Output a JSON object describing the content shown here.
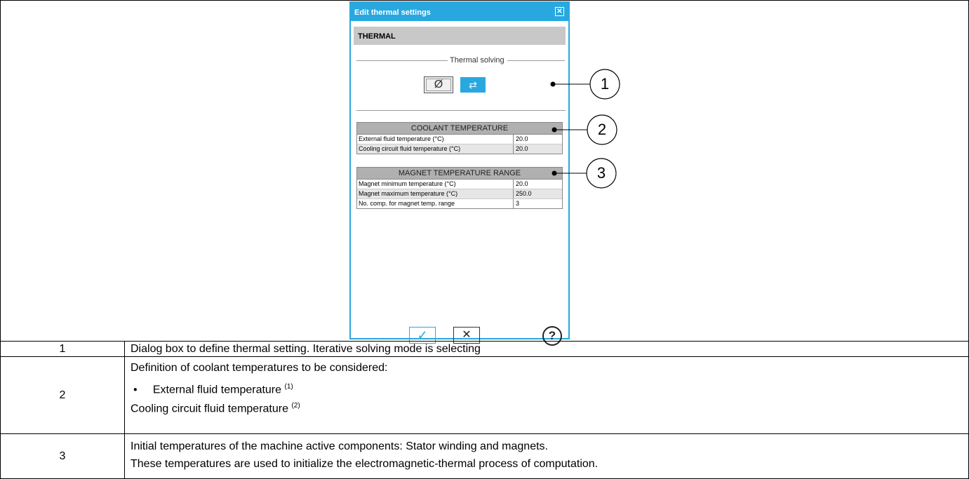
{
  "dialog": {
    "title": "Edit thermal settings",
    "section": "THERMAL",
    "solving_label": "Thermal solving",
    "null_symbol": "Ø",
    "iter_symbol": "⇄",
    "coolant": {
      "header": "COOLANT TEMPERATURE",
      "rows": [
        {
          "label": "External fluid temperature (°C)",
          "value": "20.0"
        },
        {
          "label": "Cooling circuit fluid temperature (°C)",
          "value": "20.0"
        }
      ]
    },
    "magnet": {
      "header": "MAGNET TEMPERATURE RANGE",
      "rows": [
        {
          "label": "Magnet minimum temperature (°C)",
          "value": "20.0"
        },
        {
          "label": "Magnet maximum temperature (°C)",
          "value": "250.0"
        },
        {
          "label": "No. comp. for magnet temp. range",
          "value": "3"
        }
      ]
    },
    "ok_symbol": "✓",
    "cancel_symbol": "✕",
    "help_symbol": "?",
    "close_symbol": "✕"
  },
  "callouts": [
    "1",
    "2",
    "3"
  ],
  "rows": [
    {
      "num": "1",
      "text": "Dialog box to define thermal setting. Iterative solving mode is selecting"
    },
    {
      "num": "2",
      "line1": "Definition of coolant temperatures to be considered:",
      "bullet": "External fluid temperature",
      "bullet_sup": "(1)",
      "line3": "Cooling circuit fluid temperature",
      "line3_sup": "(2)"
    },
    {
      "num": "3",
      "line1": "Initial temperatures of the machine active components: Stator winding and magnets.",
      "line2": "These temperatures are used to initialize the electromagnetic-thermal process of computation."
    }
  ]
}
